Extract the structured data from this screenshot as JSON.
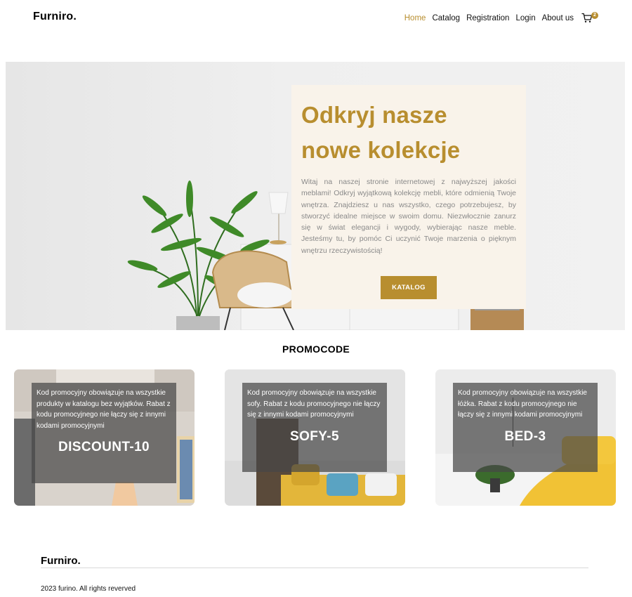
{
  "header": {
    "logo": "Furniro.",
    "nav": [
      "Home",
      "Catalog",
      "Registration",
      "Login",
      "About us"
    ],
    "cart_count": "2",
    "accent_color": "#b88e2f"
  },
  "hero": {
    "title_line1": "Odkryj nasze",
    "title_line2": "nowe kolekcje",
    "text": "Witaj na naszej stronie internetowej z najwyższej jakości meblami! Odkryj wyjątkową kolekcję mebli, które odmienią Twoje wnętrza. Znajdziesz u nas wszystko, czego potrzebujesz, by stworzyć idealne miejsce w swoim domu. Niezwłocznie zanurz się w świat elegancji i wygody, wybierając nasze meble. Jesteśmy tu, by pomóc Ci uczynić Twoje marzenia o pięknym wnętrzu rzeczywistością!",
    "button": "KATALOG",
    "card_color": "#f9f3ea"
  },
  "promo": {
    "heading": "PROMOCODE",
    "cards": [
      {
        "desc": "Kod promocyjny obowiązuje na wszystkie produkty w katalogu bez wyjątków. Rabat z kodu promocyjnego nie łączy się z innymi kodami promocyjnymi",
        "code": "DISCOUNT-10"
      },
      {
        "desc": "Kod promocyjny obowiązuje na wszystkie sofy. Rabat z kodu promocyjnego nie łączy się z innymi kodami promocyjnymi",
        "code": "SOFY-5"
      },
      {
        "desc": "Kod promocyjny obowiązuje na wszystkie łóżka. Rabat z kodu promocyjnego nie łączy się z innymi kodami promocyjnymi",
        "code": "BED-3"
      }
    ]
  },
  "footer": {
    "logo": "Furniro.",
    "copyright": "2023 furino. All rights reverved"
  },
  "icons": [
    "cart-icon"
  ]
}
